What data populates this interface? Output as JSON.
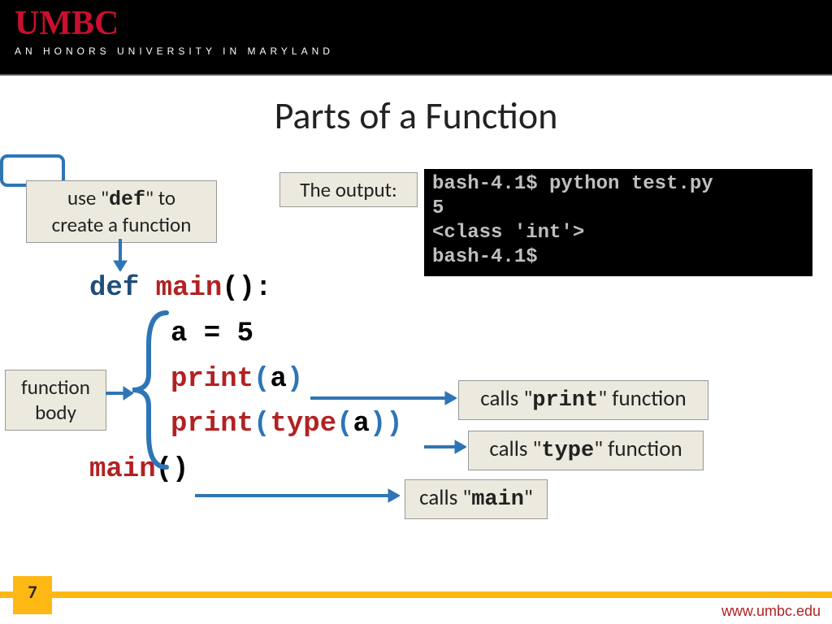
{
  "header": {
    "logo": "UMBC",
    "tagline": "AN HONORS UNIVERSITY IN MARYLAND"
  },
  "title": "Parts of a Function",
  "boxes": {
    "def_hint_a": "use \"",
    "def_hint_b": "def",
    "def_hint_c": "\" to",
    "def_hint_d": "create a function",
    "output_label": "The output:",
    "fn_body_a": "function",
    "fn_body_b": "body",
    "calls_print_a": "calls \"",
    "calls_print_b": "print",
    "calls_print_c": "\" function",
    "calls_type_a": "calls \"",
    "calls_type_b": "type",
    "calls_type_c": "\" function",
    "calls_main_a": "calls \"",
    "calls_main_b": "main",
    "calls_main_c": "\""
  },
  "terminal": "bash-4.1$ python test.py\n5\n<class 'int'>\nbash-4.1$",
  "code": {
    "l1_def": "def",
    "l1_main": " main",
    "l1_paren": "():",
    "l2": "a = 5",
    "l3_print": "print",
    "l3_open": "(",
    "l3_a": "a",
    "l3_close": ")",
    "l4_print": "print",
    "l4_open": "(",
    "l4_type": "type",
    "l4_open2": "(",
    "l4_a": "a",
    "l4_close": "))",
    "l5_main": "main",
    "l5_paren": "()"
  },
  "footer": {
    "page": "7",
    "url": "www.umbc.edu"
  }
}
